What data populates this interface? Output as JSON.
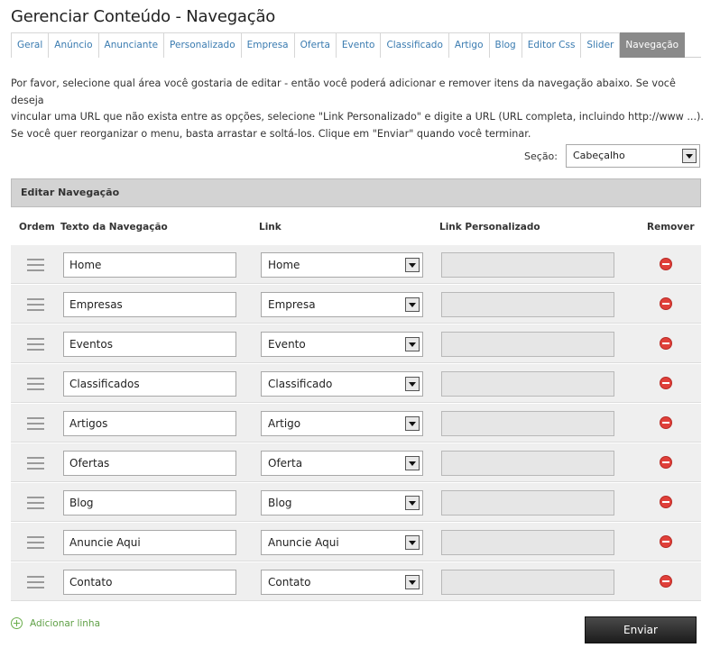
{
  "page": {
    "title": "Gerenciar Conteúdo - Navegação"
  },
  "tabs": [
    {
      "label": "Geral"
    },
    {
      "label": "Anúncio"
    },
    {
      "label": "Anunciante"
    },
    {
      "label": "Personalizado"
    },
    {
      "label": "Empresa"
    },
    {
      "label": "Oferta"
    },
    {
      "label": "Evento"
    },
    {
      "label": "Classificado"
    },
    {
      "label": "Artigo"
    },
    {
      "label": "Blog"
    },
    {
      "label": "Editor Css"
    },
    {
      "label": "Slider"
    },
    {
      "label": "Navegação",
      "active": true
    }
  ],
  "intro": {
    "line1": "Por favor, selecione qual área você gostaria de editar - então você poderá adicionar e remover itens da navegação abaixo. Se você deseja",
    "line2": "vincular uma URL que não exista entre as opções, selecione \"Link Personalizado\" e digite a URL (URL completa, incluindo http://www ...).",
    "line3": "Se você quer reorganizar o menu, basta arrastar e soltá-los. Clique em \"Enviar\" quando você terminar."
  },
  "section": {
    "label": "Seção:",
    "value": "Cabeçalho"
  },
  "panel": {
    "title": "Editar Navegação"
  },
  "columns": {
    "order": "Ordem",
    "text": "Texto da Navegação",
    "link": "Link",
    "custom": "Link Personalizado",
    "remove": "Remover"
  },
  "rows": [
    {
      "text": "Home",
      "link": "Home",
      "custom": ""
    },
    {
      "text": "Empresas",
      "link": "Empresa",
      "custom": ""
    },
    {
      "text": "Eventos",
      "link": "Evento",
      "custom": ""
    },
    {
      "text": "Classificados",
      "link": "Classificado",
      "custom": ""
    },
    {
      "text": "Artigos",
      "link": "Artigo",
      "custom": ""
    },
    {
      "text": "Ofertas",
      "link": "Oferta",
      "custom": ""
    },
    {
      "text": "Blog",
      "link": "Blog",
      "custom": ""
    },
    {
      "text": "Anuncie Aqui",
      "link": "Anuncie Aqui",
      "custom": ""
    },
    {
      "text": "Contato",
      "link": "Contato",
      "custom": ""
    }
  ],
  "actions": {
    "add_row": "Adicionar linha",
    "submit": "Enviar"
  },
  "colors": {
    "tab_link": "#3a7bb0",
    "tab_active_bg": "#8a8a8a",
    "remove": "#e0403a",
    "add": "#5fa046",
    "button_bg": "#1c1c1c"
  }
}
